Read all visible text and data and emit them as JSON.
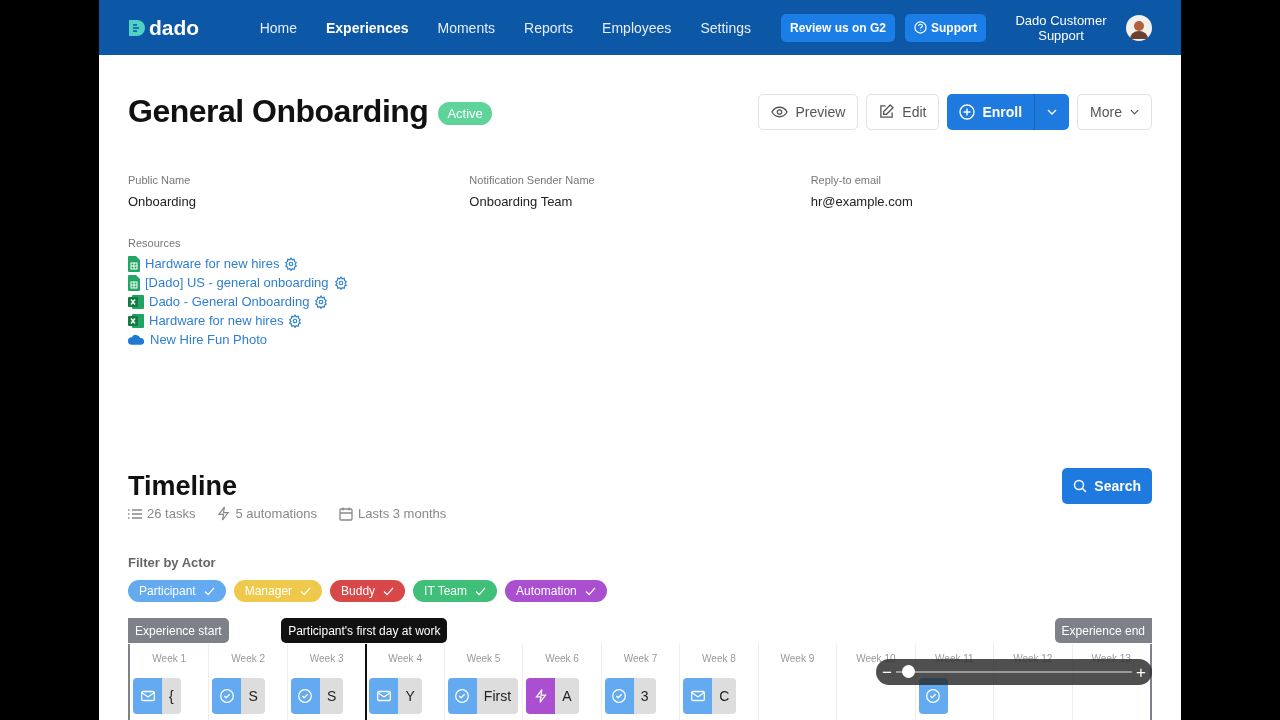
{
  "nav": {
    "logo": "dado",
    "links": [
      {
        "label": "Home",
        "selected": false
      },
      {
        "label": "Experiences",
        "selected": true
      },
      {
        "label": "Moments",
        "selected": false
      },
      {
        "label": "Reports",
        "selected": false
      },
      {
        "label": "Employees",
        "selected": false
      },
      {
        "label": "Settings",
        "selected": false
      }
    ],
    "review_button": "Review us on G2",
    "support_button": "Support",
    "user_name": "Dado Customer Support"
  },
  "header": {
    "title": "General Onboarding",
    "status": "Active",
    "preview": "Preview",
    "edit": "Edit",
    "enroll": "Enroll",
    "more": "More"
  },
  "details": [
    {
      "label": "Public Name",
      "value": "Onboarding"
    },
    {
      "label": "Notification Sender Name",
      "value": "Onboarding Team"
    },
    {
      "label": "Reply-to email",
      "value": "hr@example.com"
    }
  ],
  "resources": {
    "label": "Resources",
    "items": [
      {
        "kind": "sheet",
        "name": "Hardware for new hires",
        "settings": true
      },
      {
        "kind": "sheet",
        "name": "[Dado] US - general onboarding",
        "settings": true
      },
      {
        "kind": "excel",
        "name": "Dado - General Onboarding",
        "settings": true
      },
      {
        "kind": "excel",
        "name": "Hardware for new hires",
        "settings": true
      },
      {
        "kind": "cloud",
        "name": "New Hire Fun Photo",
        "settings": false
      }
    ]
  },
  "timeline": {
    "title": "Timeline",
    "search": "Search",
    "stats": [
      {
        "kind": "list",
        "text": "26 tasks"
      },
      {
        "kind": "bolt",
        "text": "5 automations"
      },
      {
        "kind": "calendar",
        "text": "Lasts 3 months"
      }
    ],
    "filter_label": "Filter by Actor",
    "filters": [
      {
        "label": "Participant",
        "color": "#64aaf0",
        "selected": true
      },
      {
        "label": "Manager",
        "color": "#efc94c",
        "selected": true
      },
      {
        "label": "Buddy",
        "color": "#d94848",
        "selected": true
      },
      {
        "label": "IT Team",
        "color": "#3fbf78",
        "selected": true
      },
      {
        "label": "Automation",
        "color": "#a94fd0",
        "selected": true
      }
    ],
    "markers": [
      {
        "kind": "start",
        "label": "Experience start"
      },
      {
        "kind": "milestone",
        "label": "Participant's first day at work"
      },
      {
        "kind": "end",
        "label": "Experience end"
      }
    ],
    "weeks": [
      {
        "label": "Week 1",
        "cards": [
          {
            "kind": "mail",
            "color": "#64aaf0",
            "text": "{"
          }
        ]
      },
      {
        "label": "Week 2",
        "cards": [
          {
            "kind": "check",
            "color": "#64aaf0",
            "text": "S"
          }
        ]
      },
      {
        "label": "Week 3",
        "cards": [
          {
            "kind": "check",
            "color": "#64aaf0",
            "text": "S"
          }
        ]
      },
      {
        "label": "Week 4",
        "cards": [
          {
            "kind": "mail",
            "color": "#64aaf0",
            "text": "Y"
          }
        ]
      },
      {
        "label": "Week 5",
        "cards": [
          {
            "kind": "check",
            "color": "#64aaf0",
            "text": "First"
          }
        ]
      },
      {
        "label": "Week 6",
        "cards": [
          {
            "kind": "bolt",
            "color": "#a94fd0",
            "text": "A"
          }
        ]
      },
      {
        "label": "Week 7",
        "cards": [
          {
            "kind": "check",
            "color": "#64aaf0",
            "text": "3"
          }
        ]
      },
      {
        "label": "Week 8",
        "cards": [
          {
            "kind": "mail",
            "color": "#64aaf0",
            "text": "C"
          }
        ]
      },
      {
        "label": "Week 9"
      },
      {
        "label": "Week 10"
      },
      {
        "label": "Week 11",
        "cards": [
          {
            "kind": "check",
            "color": "#64aaf0"
          }
        ]
      },
      {
        "label": "Week 12"
      },
      {
        "label": "Week 13"
      }
    ],
    "zoom": {
      "minus": "−",
      "plus": "+",
      "level": 0.05
    }
  }
}
